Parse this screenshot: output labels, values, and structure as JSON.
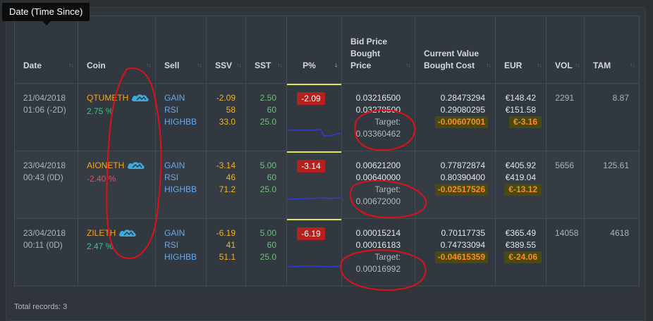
{
  "tooltip": {
    "text": "Date (Time Since)"
  },
  "columns": [
    {
      "key": "date",
      "label": "Date",
      "line1": ""
    },
    {
      "key": "coin",
      "label": "Coin",
      "line1": ""
    },
    {
      "key": "sell",
      "label": "Sell",
      "line1": ""
    },
    {
      "key": "ssv",
      "label": "SSV",
      "line1": ""
    },
    {
      "key": "sst",
      "label": "SST",
      "line1": ""
    },
    {
      "key": "pct",
      "label": "P%",
      "line1": ""
    },
    {
      "key": "bid",
      "label": "Bid Price",
      "line2": "Bought",
      "line3": "Price"
    },
    {
      "key": "cur",
      "label": "Current Value",
      "line2": "Bought Cost"
    },
    {
      "key": "eur",
      "label": "EUR"
    },
    {
      "key": "vol",
      "label": "VOL"
    },
    {
      "key": "tam",
      "label": "TAM"
    }
  ],
  "sort_icons": {
    "inactive": "↑↓",
    "active": "↓"
  },
  "rows": [
    {
      "date": "21/04/2018",
      "since": "01:06 (-2D)",
      "coin": "QTUMETH",
      "coin_pct": "2.75 %",
      "coin_pct_color": "#3cc48a",
      "sell": [
        "GAIN",
        "RSI",
        "HIGHBB"
      ],
      "ssv": [
        "-2.09",
        "58",
        "33.0"
      ],
      "sst": [
        "2.50",
        "60",
        "25.0"
      ],
      "pct": "-2.09",
      "bid": "0.03216500",
      "bought": "0.03278500",
      "target_label": "Target:",
      "target": "0.03360462",
      "cur": "0.28473294",
      "cost": "0.29080295",
      "diff": "-0.00607001",
      "eur1": "€148.42",
      "eur2": "€151.58",
      "eur_diff": "€-3.16",
      "vol": "2291",
      "tam": "8.87"
    },
    {
      "date": "23/04/2018",
      "since": "00:43 (0D)",
      "coin": "AIONETH",
      "coin_pct": "-2.40 %",
      "coin_pct_color": "#e05252",
      "sell": [
        "GAIN",
        "RSI",
        "HIGHBB"
      ],
      "ssv": [
        "-3.14",
        "46",
        "71.2"
      ],
      "sst": [
        "5.00",
        "60",
        "25.0"
      ],
      "pct": "-3.14",
      "bid": "0.00621200",
      "bought": "0.00640000",
      "target_label": "Target:",
      "target": "0.00672000",
      "cur": "0.77872874",
      "cost": "0.80390400",
      "diff": "-0.02517526",
      "eur1": "€405.92",
      "eur2": "€419.04",
      "eur_diff": "€-13.12",
      "vol": "5656",
      "tam": "125.61"
    },
    {
      "date": "23/04/2018",
      "since": "00:11 (0D)",
      "coin": "ZILETH",
      "coin_pct": "2.47 %",
      "coin_pct_color": "#3cc48a",
      "sell": [
        "GAIN",
        "RSI",
        "HIGHBB"
      ],
      "ssv": [
        "-6.19",
        "41",
        "51.1"
      ],
      "sst": [
        "5.00",
        "60",
        "25.0"
      ],
      "pct": "-6.19",
      "bid": "0.00015214",
      "bought": "0.00016183",
      "target_label": "Target:",
      "target": "0.00016992",
      "cur": "0.70117735",
      "cost": "0.74733094",
      "diff": "-0.04615359",
      "eur1": "€365.49",
      "eur2": "€389.55",
      "eur_diff": "€-24.06",
      "vol": "14058",
      "tam": "4618"
    }
  ],
  "footer": {
    "total": "Total records: 3"
  },
  "colors": {
    "accent_cloud": "#3fa9dd",
    "annotation": "#e0101a",
    "badge": "#b4211f",
    "highlight_bg": "#4a4a10",
    "highlight_fg": "#ff8a2a"
  },
  "icons": {
    "coin_cloud": "cloud-icon",
    "sort": "sort-icon"
  }
}
